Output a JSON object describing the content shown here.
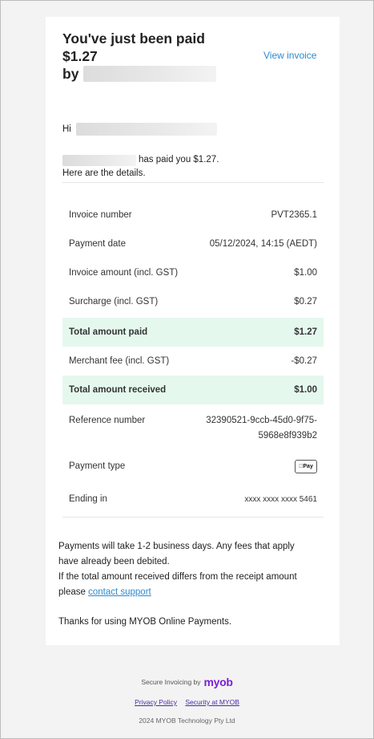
{
  "title": {
    "line1": "You've just been paid",
    "line2": "$1.27",
    "line3": "by"
  },
  "view_invoice": "View invoice",
  "greeting": "Hi",
  "paid_message": "has paid you $1.27.",
  "details_intro": "Here are the details.",
  "details": [
    {
      "label": "Invoice number",
      "value": "PVT2365.1"
    },
    {
      "label": "Payment date",
      "value": "05/12/2024, 14:15 (AEDT)"
    },
    {
      "label": "Invoice amount (incl. GST)",
      "value": "$1.00"
    },
    {
      "label": "Surcharge (incl. GST)",
      "value": "$0.27"
    },
    {
      "label": "Total amount paid",
      "value": "$1.27"
    },
    {
      "label": "Merchant fee (incl. GST)",
      "value": "-$0.27"
    },
    {
      "label": "Total amount received",
      "value": "$1.00"
    },
    {
      "label": "Reference number",
      "value_line1": "32390521-9ccb-45d0-9f75-",
      "value_line2": "5968e8f939b2"
    },
    {
      "label": "Payment type",
      "badge": "Pay"
    },
    {
      "label": "Ending in",
      "value": "xxxx xxxx xxxx 5461"
    }
  ],
  "note": {
    "line1": "Payments will take 1-2 business days. Any fees that apply",
    "line2": "have already been debited.",
    "line3": "If the total amount received differs from the receipt amount",
    "line4_prefix": "please",
    "contact_link": "contact support"
  },
  "thanks": "Thanks for using MYOB Online Payments.",
  "footer": {
    "secure_text": "Secure Invoicing by",
    "brand": "myob",
    "privacy": "Privacy Policy",
    "security": "Security at MYOB",
    "copyright": "2024 MYOB Technology Pty Ltd"
  },
  "colors": {
    "highlight_row": "#e5f8ee",
    "link": "#2a8ad1",
    "brand": "#7a1fd6"
  }
}
